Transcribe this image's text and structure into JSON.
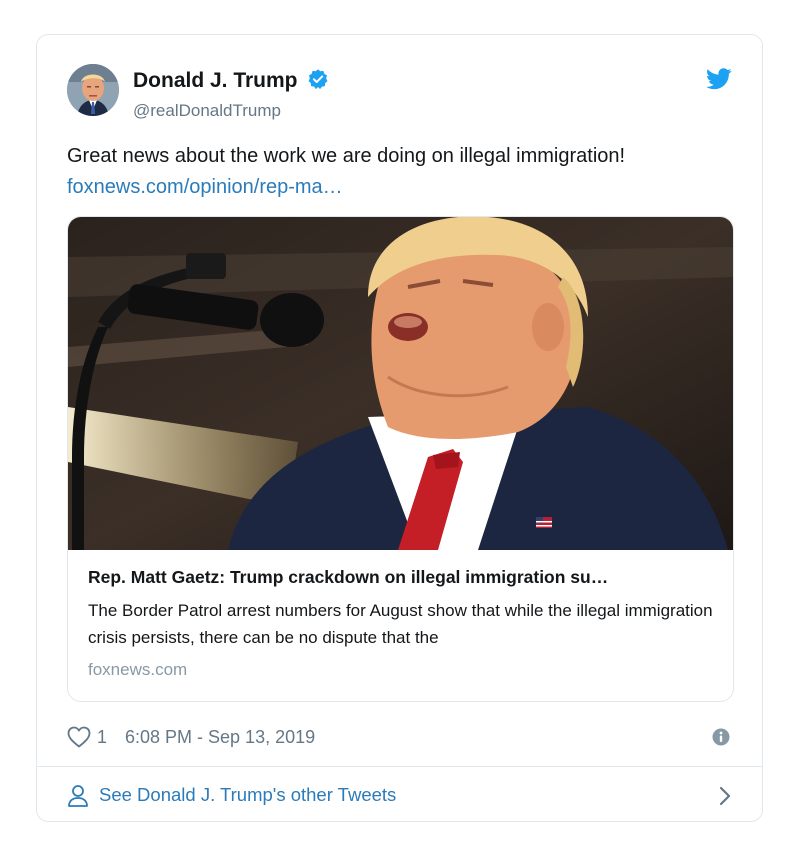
{
  "tweet": {
    "author": {
      "display_name": "Donald J. Trump",
      "handle": "@realDonaldTrump",
      "verified": true
    },
    "text": "Great news about the work we are doing on illegal immigration!",
    "link": "foxnews.com/opinion/rep-ma…",
    "card": {
      "title": "Rep. Matt Gaetz: Trump crackdown on illegal immigration su…",
      "description": "The Border Patrol arrest numbers for August show that while the illegal immigration crisis persists, there can be no dispute that the",
      "domain": "foxnews.com"
    },
    "likes": "1",
    "timestamp": "6:08 PM - Sep 13, 2019",
    "footer_label": "See Donald J. Trump's other Tweets"
  },
  "colors": {
    "twitter_blue": "#1da1f2",
    "link_blue": "#2b7bb9",
    "secondary_text": "#657786",
    "border": "#e1e8ed"
  },
  "icons": [
    "verified-badge-icon",
    "twitter-bird-icon",
    "heart-icon",
    "info-icon",
    "person-icon",
    "chevron-right-icon"
  ]
}
